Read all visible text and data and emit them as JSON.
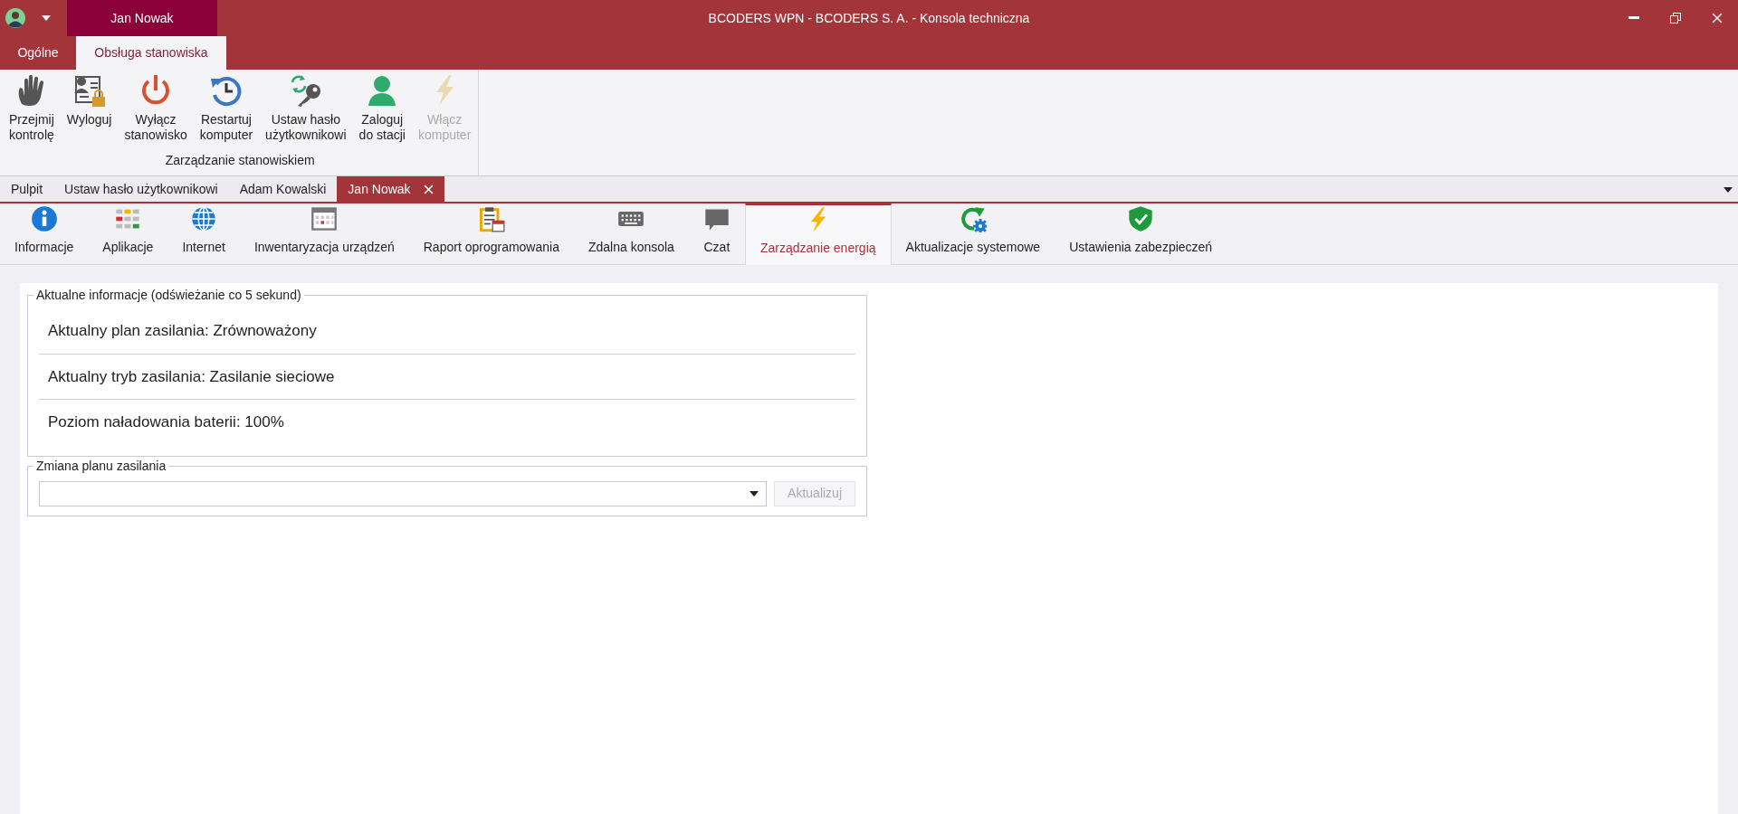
{
  "window": {
    "title": "BCODERS WPN - BCODERS S. A. - Konsola techniczna",
    "context_tab": "Jan Nowak"
  },
  "ribbon": {
    "tabs": [
      {
        "label": "Ogólne",
        "selected": false
      },
      {
        "label": "Obsługa stanowiska",
        "selected": true
      }
    ],
    "groups": [
      {
        "label": "Zarządzanie stanowiskiem",
        "buttons": [
          {
            "kind": "hand",
            "lines": [
              "Przejmij",
              "kontrolę"
            ],
            "disabled": false
          },
          {
            "kind": "logout",
            "lines": [
              "Wyloguj"
            ],
            "disabled": false
          },
          {
            "kind": "power",
            "lines": [
              "Wyłącz",
              "stanowisko"
            ],
            "disabled": false
          },
          {
            "kind": "restart",
            "lines": [
              "Restartuj",
              "komputer"
            ],
            "disabled": false
          },
          {
            "kind": "key",
            "lines": [
              "Ustaw hasło",
              "użytkownikowi"
            ],
            "disabled": false
          },
          {
            "kind": "user",
            "lines": [
              "Zaloguj",
              "do stacji"
            ],
            "disabled": false
          },
          {
            "kind": "bolt",
            "lines": [
              "Włącz",
              "komputer"
            ],
            "disabled": true
          }
        ]
      }
    ]
  },
  "document_tabs": [
    {
      "label": "Pulpit",
      "selected": false,
      "closable": false
    },
    {
      "label": "Ustaw hasło użytkownikowi",
      "selected": false,
      "closable": false
    },
    {
      "label": "Adam Kowalski",
      "selected": false,
      "closable": false
    },
    {
      "label": "Jan Nowak",
      "selected": true,
      "closable": true
    }
  ],
  "feature_tabs": [
    {
      "kind": "info",
      "label": "Informacje",
      "selected": false
    },
    {
      "kind": "apps",
      "label": "Aplikacje",
      "selected": false
    },
    {
      "kind": "globe",
      "label": "Internet",
      "selected": false
    },
    {
      "kind": "calendar",
      "label": "Inwentaryzacja urządzeń",
      "selected": false
    },
    {
      "kind": "report",
      "label": "Raport oprogramowania",
      "selected": false
    },
    {
      "kind": "keyboard",
      "label": "Zdalna konsola",
      "selected": false
    },
    {
      "kind": "chat",
      "label": "Czat",
      "selected": false
    },
    {
      "kind": "bolt",
      "label": "Zarządzanie energią",
      "selected": true
    },
    {
      "kind": "update",
      "label": "Aktualizacje systemowe",
      "selected": false
    },
    {
      "kind": "shield",
      "label": "Ustawienia zabezpieczeń",
      "selected": false
    }
  ],
  "info_group": {
    "legend": "Aktualne informacje (odświeżanie co 5 sekund)",
    "rows": [
      "Aktualny plan zasilania: Zrównoważony",
      "Aktualny tryb zasilania: Zasilanie sieciowe",
      "Poziom naładowania baterii: 100%"
    ]
  },
  "plan_group": {
    "legend": "Zmiana planu zasilania",
    "button": {
      "label": "Aktualizuj",
      "disabled": true
    }
  }
}
